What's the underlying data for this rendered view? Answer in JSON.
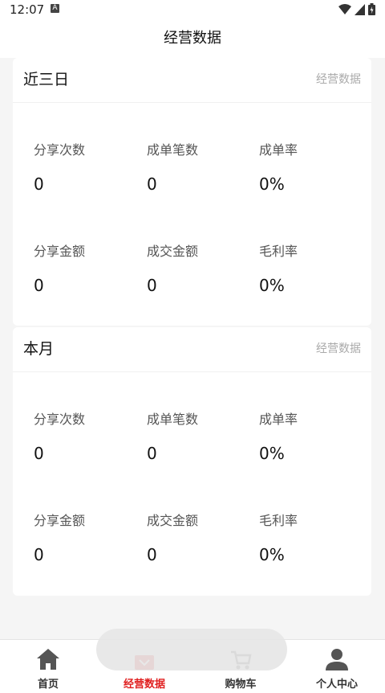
{
  "status_bar": {
    "time": "12:07",
    "notification_letter": "A"
  },
  "header": {
    "title": "经营数据"
  },
  "sections": [
    {
      "title": "近三日",
      "link": "经营数据",
      "stats": [
        {
          "label": "分享次数",
          "value": "0"
        },
        {
          "label": "成单笔数",
          "value": "0"
        },
        {
          "label": "成单率",
          "value": "0%"
        },
        {
          "label": "分享金额",
          "value": "0"
        },
        {
          "label": "成交金额",
          "value": "0"
        },
        {
          "label": "毛利率",
          "value": "0%"
        }
      ]
    },
    {
      "title": "本月",
      "link": "经营数据",
      "stats": [
        {
          "label": "分享次数",
          "value": "0"
        },
        {
          "label": "成单笔数",
          "value": "0"
        },
        {
          "label": "成单率",
          "value": "0%"
        },
        {
          "label": "分享金额",
          "value": "0"
        },
        {
          "label": "成交金额",
          "value": "0"
        },
        {
          "label": "毛利率",
          "value": "0%"
        }
      ]
    }
  ],
  "tabbar": {
    "items": [
      {
        "label": "首页",
        "icon": "home-icon"
      },
      {
        "label": "经营数据",
        "icon": "data-icon",
        "active": true
      },
      {
        "label": "购物车",
        "icon": "cart-icon"
      },
      {
        "label": "个人中心",
        "icon": "user-icon"
      }
    ]
  },
  "colors": {
    "accent": "#e02020",
    "background": "#f5f5f5",
    "card": "#ffffff"
  }
}
